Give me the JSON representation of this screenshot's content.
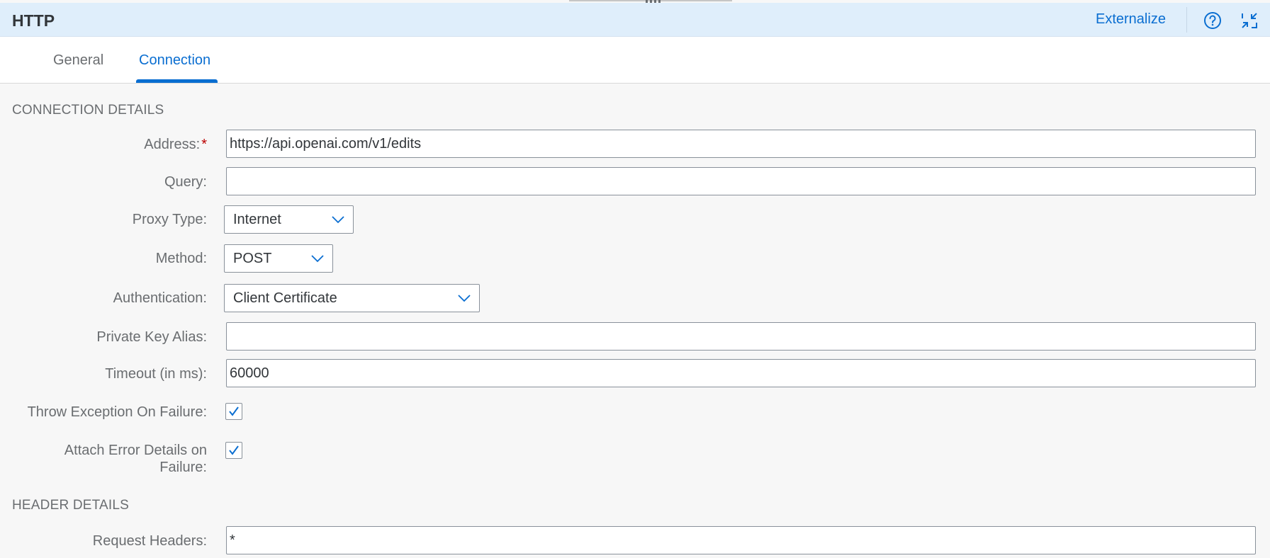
{
  "header": {
    "title": "HTTP",
    "externalize_label": "Externalize",
    "help_icon": "help-circle-icon",
    "collapse_icon": "exit-fullscreen-icon"
  },
  "tabs": [
    {
      "label": "General",
      "active": false
    },
    {
      "label": "Connection",
      "active": true
    }
  ],
  "connection_details": {
    "section_title": "CONNECTION DETAILS",
    "address": {
      "label": "Address:",
      "required_mark": "*",
      "value": "https://api.openai.com/v1/edits"
    },
    "query": {
      "label": "Query:",
      "value": ""
    },
    "proxy_type": {
      "label": "Proxy Type:",
      "value": "Internet"
    },
    "method": {
      "label": "Method:",
      "value": "POST"
    },
    "authentication": {
      "label": "Authentication:",
      "value": "Client Certificate"
    },
    "private_key_alias": {
      "label": "Private Key Alias:",
      "value": ""
    },
    "timeout": {
      "label": "Timeout (in ms):",
      "value": "60000"
    },
    "throw_exception": {
      "label": "Throw Exception On Failure:",
      "checked": true
    },
    "attach_error_details": {
      "label_line1": "Attach Error Details on",
      "label_line2": "Failure:",
      "checked": true
    }
  },
  "header_details": {
    "section_title": "HEADER DETAILS",
    "request_headers": {
      "label": "Request Headers:",
      "value": "*"
    }
  },
  "colors": {
    "accent": "#0a6ed1",
    "header_bg": "#dfeefb",
    "page_bg": "#f7f7f7",
    "required": "#bb0000"
  }
}
